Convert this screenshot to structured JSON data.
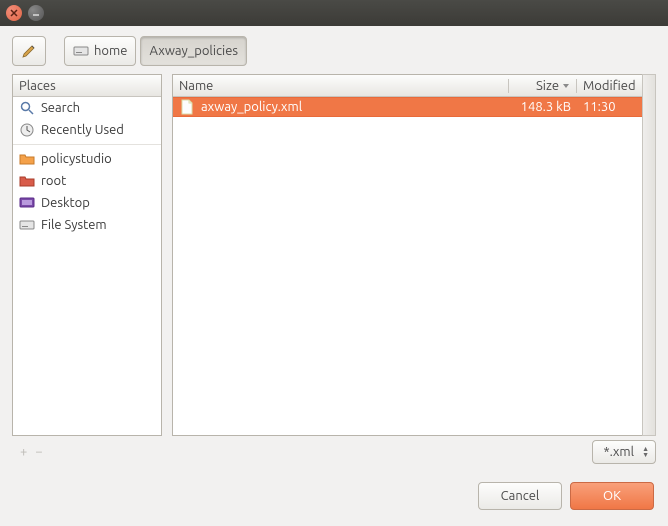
{
  "breadcrumb": {
    "home": "home",
    "current": "Axway_policies"
  },
  "places": {
    "header": "Places",
    "items": [
      {
        "label": "Search",
        "icon": "search"
      },
      {
        "label": "Recently Used",
        "icon": "recent"
      },
      {
        "label": "policystudio",
        "icon": "folder-orange"
      },
      {
        "label": "root",
        "icon": "folder-red"
      },
      {
        "label": "Desktop",
        "icon": "desktop"
      },
      {
        "label": "File System",
        "icon": "drive"
      }
    ]
  },
  "files": {
    "columns": {
      "name": "Name",
      "size": "Size",
      "modified": "Modified"
    },
    "rows": [
      {
        "name": "axway_policy.xml",
        "size": "148.3 kB",
        "modified": "11:30",
        "selected": true
      }
    ]
  },
  "filter": {
    "label": "*.xml"
  },
  "buttons": {
    "cancel": "Cancel",
    "ok": "OK"
  },
  "colors": {
    "accent": "#f07746"
  }
}
